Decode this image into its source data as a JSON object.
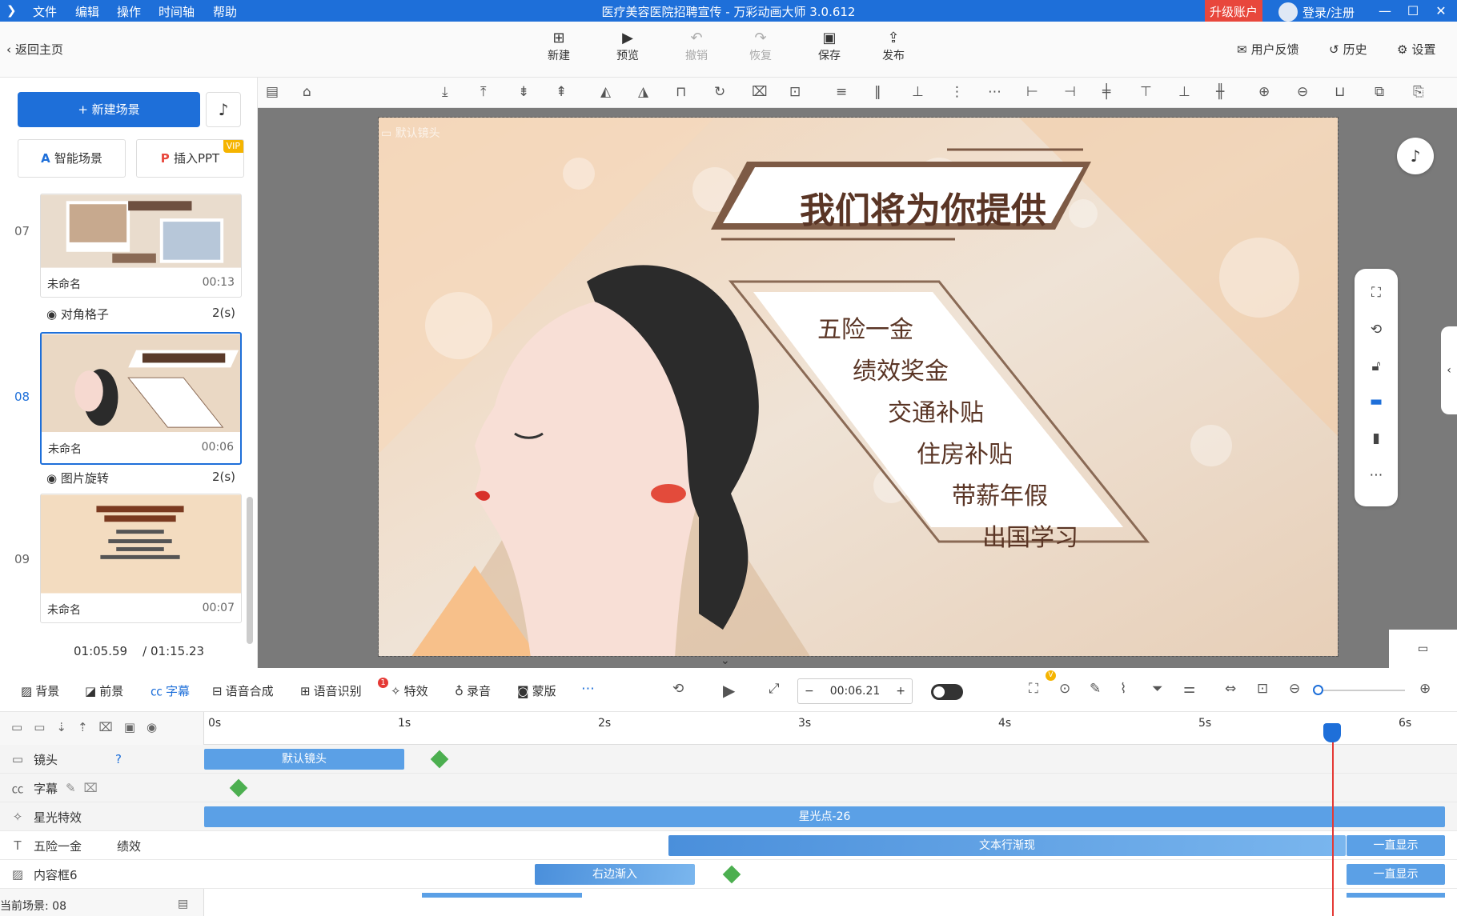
{
  "app": {
    "title": "医疗美容医院招聘宣传 - 万彩动画大师 3.0.612",
    "menus": [
      "文件",
      "编辑",
      "操作",
      "时间轴",
      "帮助"
    ],
    "upgrade": "升级账户",
    "login": "登录/注册"
  },
  "toolbar": {
    "back": "返回主页",
    "buttons": [
      "新建",
      "预览",
      "撤销",
      "恢复",
      "保存",
      "发布"
    ],
    "right": [
      "用户反馈",
      "历史",
      "设置"
    ]
  },
  "left": {
    "new_scene": "+ 新建场景",
    "smart": "智能场景",
    "ppt": "插入PPT",
    "vip": "VIP",
    "scenes": [
      {
        "num": "07",
        "name": "未命名",
        "dur": "00:13"
      },
      {
        "num": "08",
        "name": "未命名",
        "dur": "00:06"
      },
      {
        "num": "09",
        "name": "未命名",
        "dur": "00:07"
      }
    ],
    "transitions": [
      {
        "name": "对角格子",
        "dur": "2(s)"
      },
      {
        "name": "图片旋转",
        "dur": "2(s)"
      }
    ],
    "time_current": "01:05.59",
    "time_total": "/ 01:15.23"
  },
  "stage": {
    "camera": "默认镜头",
    "heading": "我们将为你提供",
    "benefits": [
      "五险一金",
      "绩效奖金",
      "交通补贴",
      "住房补贴",
      "带薪年假",
      "出国学习"
    ]
  },
  "timeline_bar": {
    "tools": [
      "背景",
      "前景",
      "字幕",
      "语音合成",
      "语音识别",
      "特效",
      "录音",
      "蒙版"
    ],
    "badge": "1",
    "time": "00:06.21",
    "v_badge": "V"
  },
  "ruler": [
    "0s",
    "1s",
    "2s",
    "3s",
    "4s",
    "5s",
    "6s"
  ],
  "tracks": [
    {
      "label": "镜头",
      "clips": [
        "默认镜头"
      ]
    },
    {
      "label": "字幕",
      "clips": []
    },
    {
      "label": "星光特效",
      "clips": [
        "星光点-26"
      ]
    },
    {
      "label": "五险一金",
      "extra": "绩效",
      "clips": [
        "文本行渐现",
        "一直显示"
      ]
    },
    {
      "label": "内容框6",
      "clips": [
        "右边渐入",
        "一直显示"
      ]
    }
  ],
  "status": "当前场景: 08"
}
